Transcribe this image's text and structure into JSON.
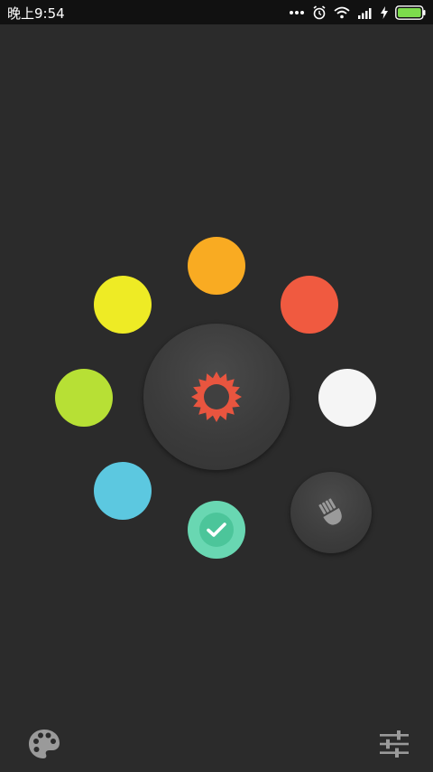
{
  "status_bar": {
    "time": "晚上9:54",
    "icons": [
      "more-dots-icon",
      "alarm-icon",
      "wifi-icon",
      "signal-icon",
      "charging-icon",
      "battery-icon"
    ]
  },
  "color_swatches": [
    {
      "name": "orange",
      "color": "#f9ab22"
    },
    {
      "name": "red",
      "color": "#f05a40"
    },
    {
      "name": "yellow",
      "color": "#eeeb25"
    },
    {
      "name": "green",
      "color": "#b7e035"
    },
    {
      "name": "white",
      "color": "#f5f5f5"
    },
    {
      "name": "cyan",
      "color": "#5cc8e0"
    },
    {
      "name": "mint",
      "color": "#69d7b2",
      "selected": true
    }
  ],
  "center_icon": {
    "name": "sun-icon",
    "color": "#e8553f"
  },
  "brush_button": {
    "icon": "brush-icon"
  },
  "bottom_bar": {
    "left_icon": "palette-icon",
    "right_icon": "sliders-icon"
  },
  "colors": {
    "background": "#2b2b2b",
    "status_bar": "#111111",
    "icon_gray": "#9a9a9a",
    "battery_green": "#7ddc4c"
  }
}
